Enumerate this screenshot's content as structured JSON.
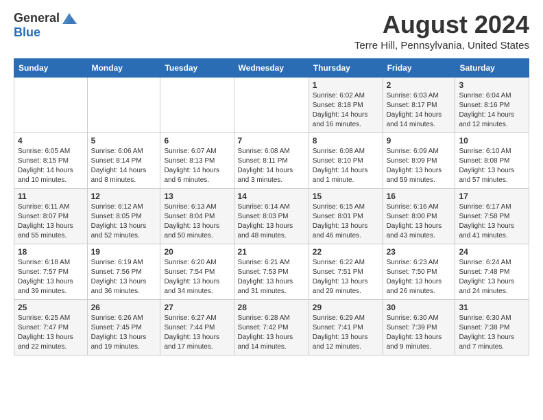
{
  "header": {
    "logo_general": "General",
    "logo_blue": "Blue",
    "month_title": "August 2024",
    "location": "Terre Hill, Pennsylvania, United States"
  },
  "calendar": {
    "weekdays": [
      "Sunday",
      "Monday",
      "Tuesday",
      "Wednesday",
      "Thursday",
      "Friday",
      "Saturday"
    ],
    "weeks": [
      [
        {
          "day": "",
          "info": ""
        },
        {
          "day": "",
          "info": ""
        },
        {
          "day": "",
          "info": ""
        },
        {
          "day": "",
          "info": ""
        },
        {
          "day": "1",
          "info": "Sunrise: 6:02 AM\nSunset: 8:18 PM\nDaylight: 14 hours and 16 minutes."
        },
        {
          "day": "2",
          "info": "Sunrise: 6:03 AM\nSunset: 8:17 PM\nDaylight: 14 hours and 14 minutes."
        },
        {
          "day": "3",
          "info": "Sunrise: 6:04 AM\nSunset: 8:16 PM\nDaylight: 14 hours and 12 minutes."
        }
      ],
      [
        {
          "day": "4",
          "info": "Sunrise: 6:05 AM\nSunset: 8:15 PM\nDaylight: 14 hours and 10 minutes."
        },
        {
          "day": "5",
          "info": "Sunrise: 6:06 AM\nSunset: 8:14 PM\nDaylight: 14 hours and 8 minutes."
        },
        {
          "day": "6",
          "info": "Sunrise: 6:07 AM\nSunset: 8:13 PM\nDaylight: 14 hours and 6 minutes."
        },
        {
          "day": "7",
          "info": "Sunrise: 6:08 AM\nSunset: 8:11 PM\nDaylight: 14 hours and 3 minutes."
        },
        {
          "day": "8",
          "info": "Sunrise: 6:08 AM\nSunset: 8:10 PM\nDaylight: 14 hours and 1 minute."
        },
        {
          "day": "9",
          "info": "Sunrise: 6:09 AM\nSunset: 8:09 PM\nDaylight: 13 hours and 59 minutes."
        },
        {
          "day": "10",
          "info": "Sunrise: 6:10 AM\nSunset: 8:08 PM\nDaylight: 13 hours and 57 minutes."
        }
      ],
      [
        {
          "day": "11",
          "info": "Sunrise: 6:11 AM\nSunset: 8:07 PM\nDaylight: 13 hours and 55 minutes."
        },
        {
          "day": "12",
          "info": "Sunrise: 6:12 AM\nSunset: 8:05 PM\nDaylight: 13 hours and 52 minutes."
        },
        {
          "day": "13",
          "info": "Sunrise: 6:13 AM\nSunset: 8:04 PM\nDaylight: 13 hours and 50 minutes."
        },
        {
          "day": "14",
          "info": "Sunrise: 6:14 AM\nSunset: 8:03 PM\nDaylight: 13 hours and 48 minutes."
        },
        {
          "day": "15",
          "info": "Sunrise: 6:15 AM\nSunset: 8:01 PM\nDaylight: 13 hours and 46 minutes."
        },
        {
          "day": "16",
          "info": "Sunrise: 6:16 AM\nSunset: 8:00 PM\nDaylight: 13 hours and 43 minutes."
        },
        {
          "day": "17",
          "info": "Sunrise: 6:17 AM\nSunset: 7:58 PM\nDaylight: 13 hours and 41 minutes."
        }
      ],
      [
        {
          "day": "18",
          "info": "Sunrise: 6:18 AM\nSunset: 7:57 PM\nDaylight: 13 hours and 39 minutes."
        },
        {
          "day": "19",
          "info": "Sunrise: 6:19 AM\nSunset: 7:56 PM\nDaylight: 13 hours and 36 minutes."
        },
        {
          "day": "20",
          "info": "Sunrise: 6:20 AM\nSunset: 7:54 PM\nDaylight: 13 hours and 34 minutes."
        },
        {
          "day": "21",
          "info": "Sunrise: 6:21 AM\nSunset: 7:53 PM\nDaylight: 13 hours and 31 minutes."
        },
        {
          "day": "22",
          "info": "Sunrise: 6:22 AM\nSunset: 7:51 PM\nDaylight: 13 hours and 29 minutes."
        },
        {
          "day": "23",
          "info": "Sunrise: 6:23 AM\nSunset: 7:50 PM\nDaylight: 13 hours and 26 minutes."
        },
        {
          "day": "24",
          "info": "Sunrise: 6:24 AM\nSunset: 7:48 PM\nDaylight: 13 hours and 24 minutes."
        }
      ],
      [
        {
          "day": "25",
          "info": "Sunrise: 6:25 AM\nSunset: 7:47 PM\nDaylight: 13 hours and 22 minutes."
        },
        {
          "day": "26",
          "info": "Sunrise: 6:26 AM\nSunset: 7:45 PM\nDaylight: 13 hours and 19 minutes."
        },
        {
          "day": "27",
          "info": "Sunrise: 6:27 AM\nSunset: 7:44 PM\nDaylight: 13 hours and 17 minutes."
        },
        {
          "day": "28",
          "info": "Sunrise: 6:28 AM\nSunset: 7:42 PM\nDaylight: 13 hours and 14 minutes."
        },
        {
          "day": "29",
          "info": "Sunrise: 6:29 AM\nSunset: 7:41 PM\nDaylight: 13 hours and 12 minutes."
        },
        {
          "day": "30",
          "info": "Sunrise: 6:30 AM\nSunset: 7:39 PM\nDaylight: 13 hours and 9 minutes."
        },
        {
          "day": "31",
          "info": "Sunrise: 6:30 AM\nSunset: 7:38 PM\nDaylight: 13 hours and 7 minutes."
        }
      ]
    ]
  }
}
